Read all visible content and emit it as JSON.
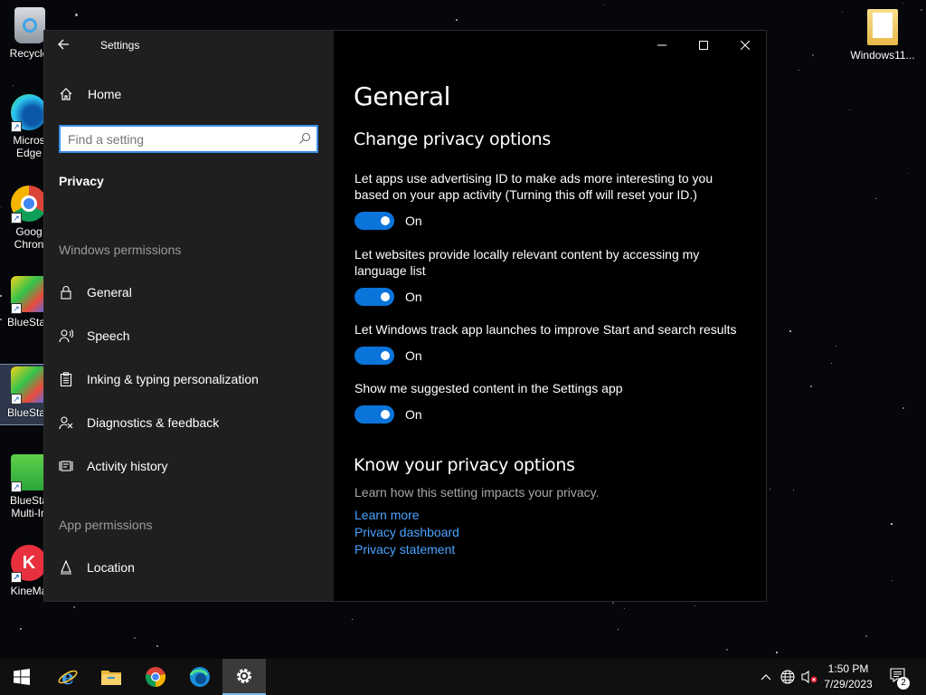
{
  "desktop": {
    "icons_left": [
      {
        "label": "Recycle",
        "kind": "recycle-bin"
      },
      {
        "label": "Micros Edge",
        "kind": "edge"
      },
      {
        "label": "Goog Chron",
        "kind": "chrome"
      },
      {
        "label": "BlueStac",
        "kind": "bluestacks"
      },
      {
        "label": "BlueStac",
        "kind": "bluestacks"
      },
      {
        "label": "BlueSta Multi-In",
        "kind": "bluestacks-multi"
      },
      {
        "label": "KineMa",
        "kind": "kinemaster"
      }
    ],
    "icon_right": {
      "label": "Windows11...",
      "kind": "folder"
    }
  },
  "window": {
    "title": "Settings",
    "home_label": "Home",
    "search_placeholder": "Find a setting",
    "current_section": "Privacy",
    "groups": [
      {
        "header": "Windows permissions",
        "items": [
          {
            "label": "General",
            "icon": "lock-icon"
          },
          {
            "label": "Speech",
            "icon": "speech-icon"
          },
          {
            "label": "Inking & typing personalization",
            "icon": "clipboard-icon"
          },
          {
            "label": "Diagnostics & feedback",
            "icon": "feedback-icon"
          },
          {
            "label": "Activity history",
            "icon": "activity-icon"
          }
        ]
      },
      {
        "header": "App permissions",
        "items": [
          {
            "label": "Location",
            "icon": "location-icon"
          }
        ]
      }
    ]
  },
  "content": {
    "page_title": "General",
    "section1_title": "Change privacy options",
    "options": [
      {
        "text": "Let apps use advertising ID to make ads more interesting to you based on your app activity (Turning this off will reset your ID.)",
        "state": "On"
      },
      {
        "text": "Let websites provide locally relevant content by accessing my language list",
        "state": "On"
      },
      {
        "text": "Let Windows track app launches to improve Start and search results",
        "state": "On"
      },
      {
        "text": "Show me suggested content in the Settings app",
        "state": "On"
      }
    ],
    "section2_title": "Know your privacy options",
    "section2_desc": "Learn how this setting impacts your privacy.",
    "links": [
      "Learn more",
      "Privacy dashboard",
      "Privacy statement"
    ]
  },
  "taskbar": {
    "time": "1:50 PM",
    "date": "7/29/2023",
    "notification_count": "2",
    "pinned": [
      "start-icon",
      "internet-explorer-icon",
      "file-explorer-icon",
      "chrome-icon",
      "edge-icon",
      "settings-icon"
    ]
  },
  "colors": {
    "accent": "#0a74da",
    "link": "#4aa3ff",
    "sidebar": "#1f1f1f"
  }
}
